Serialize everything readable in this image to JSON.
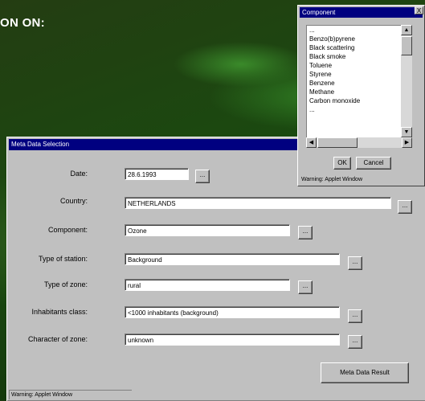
{
  "heading": "ON ON:",
  "dialog": {
    "title": "Meta Data Selection",
    "fields": [
      {
        "label": "Date:",
        "value": "28.6.1993"
      },
      {
        "label": "Country:",
        "value": "NETHERLANDS"
      },
      {
        "label": "Component:",
        "value": "Ozone"
      },
      {
        "label": "Type of station:",
        "value": "Background"
      },
      {
        "label": "Type of zone:",
        "value": "rural"
      },
      {
        "label": "Inhabitants class:",
        "value": "<1000 inhabitants (background)"
      },
      {
        "label": "Character of zone:",
        "value": "unknown"
      }
    ],
    "browse_label": "...",
    "result_button": "Meta Data Result",
    "status": "Warning: Applet Window"
  },
  "popup": {
    "title": "Component",
    "close": "X",
    "items": [
      "...",
      "Benzo(b)pyrene",
      "Black scattering",
      "Black smoke",
      "Toluene",
      "Styrene",
      "Benzene",
      "Methane",
      "Carbon monoxide",
      "..."
    ],
    "ok": "OK",
    "cancel": "Cancel",
    "status": "Warning: Applet Window"
  }
}
